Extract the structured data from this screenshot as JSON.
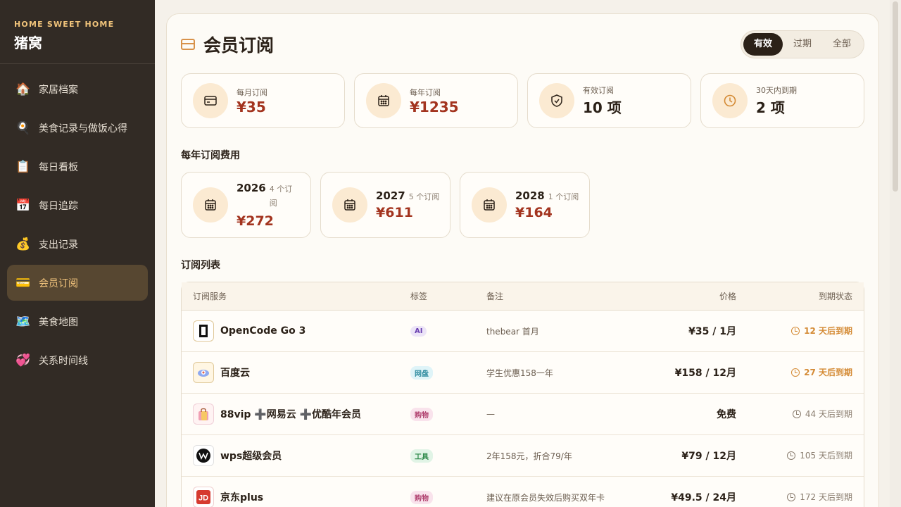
{
  "sidebar": {
    "brand_sub": "HOME SWEET HOME",
    "brand_title": "猪窝",
    "items": [
      {
        "icon": "🏠",
        "label": "家居档案"
      },
      {
        "icon": "🍳",
        "label": "美食记录与做饭心得"
      },
      {
        "icon": "📋",
        "label": "每日看板"
      },
      {
        "icon": "📅",
        "label": "每日追踪"
      },
      {
        "icon": "💰",
        "label": "支出记录"
      },
      {
        "icon": "💳",
        "label": "会员订阅"
      },
      {
        "icon": "🗺️",
        "label": "美食地图"
      },
      {
        "icon": "💞",
        "label": "关系时间线"
      }
    ]
  },
  "header": {
    "title": "会员订阅",
    "filters": [
      "有效",
      "过期",
      "全部"
    ]
  },
  "stats": [
    {
      "label": "每月订阅",
      "value": "¥35",
      "icon": "card-icon"
    },
    {
      "label": "每年订阅",
      "value": "¥1235",
      "icon": "calendar-icon"
    },
    {
      "label": "有效订阅",
      "value": "10 项",
      "icon": "shield-check-icon"
    },
    {
      "label": "30天内到期",
      "value": "2 项",
      "icon": "clock-icon"
    }
  ],
  "annual": {
    "title": "每年订阅费用",
    "years": [
      {
        "year": "2026",
        "count": "4 个订阅",
        "value": "¥272"
      },
      {
        "year": "2027",
        "count": "5 个订阅",
        "value": "¥611"
      },
      {
        "year": "2028",
        "count": "1 个订阅",
        "value": "¥164"
      }
    ]
  },
  "list": {
    "title": "订阅列表",
    "headers": [
      "订阅服务",
      "标签",
      "备注",
      "价格",
      "到期状态"
    ],
    "rows": [
      {
        "name": "OpenCode Go 3",
        "tag": "AI",
        "note": "thebear 首月",
        "price": "¥35 / 1月",
        "due": "12 天后到期",
        "logo": "▯"
      },
      {
        "name": "百度云",
        "tag": "网盘",
        "note": "学生优惠158一年",
        "price": "¥158 / 12月",
        "due": "27 天后到期",
        "logo": "☁"
      },
      {
        "name": "88vip ➕网易云 ➕优酷年会员",
        "tag": "购物",
        "note": "—",
        "price": "免费",
        "due": "44 天后到期",
        "logo": "🛍"
      },
      {
        "name": "wps超级会员",
        "tag": "工具",
        "note": "2年158元，折合79/年",
        "price": "¥79 / 12月",
        "due": "105 天后到期",
        "logo": "W"
      },
      {
        "name": "京东plus",
        "tag": "购物",
        "note": "建议在原会员失效后购买双年卡",
        "price": "¥49.5 / 24月",
        "due": "172 天后到期",
        "logo": "JD"
      }
    ]
  },
  "colors": {
    "accent": "#f3c57d",
    "price_red": "#a3341f",
    "warning": "#d48a34",
    "tag_ai": "#ece4f7",
    "tag_disk": "#dff4f8",
    "tag_shop": "#f9e3ec",
    "tag_tool": "#e1f4e6"
  }
}
